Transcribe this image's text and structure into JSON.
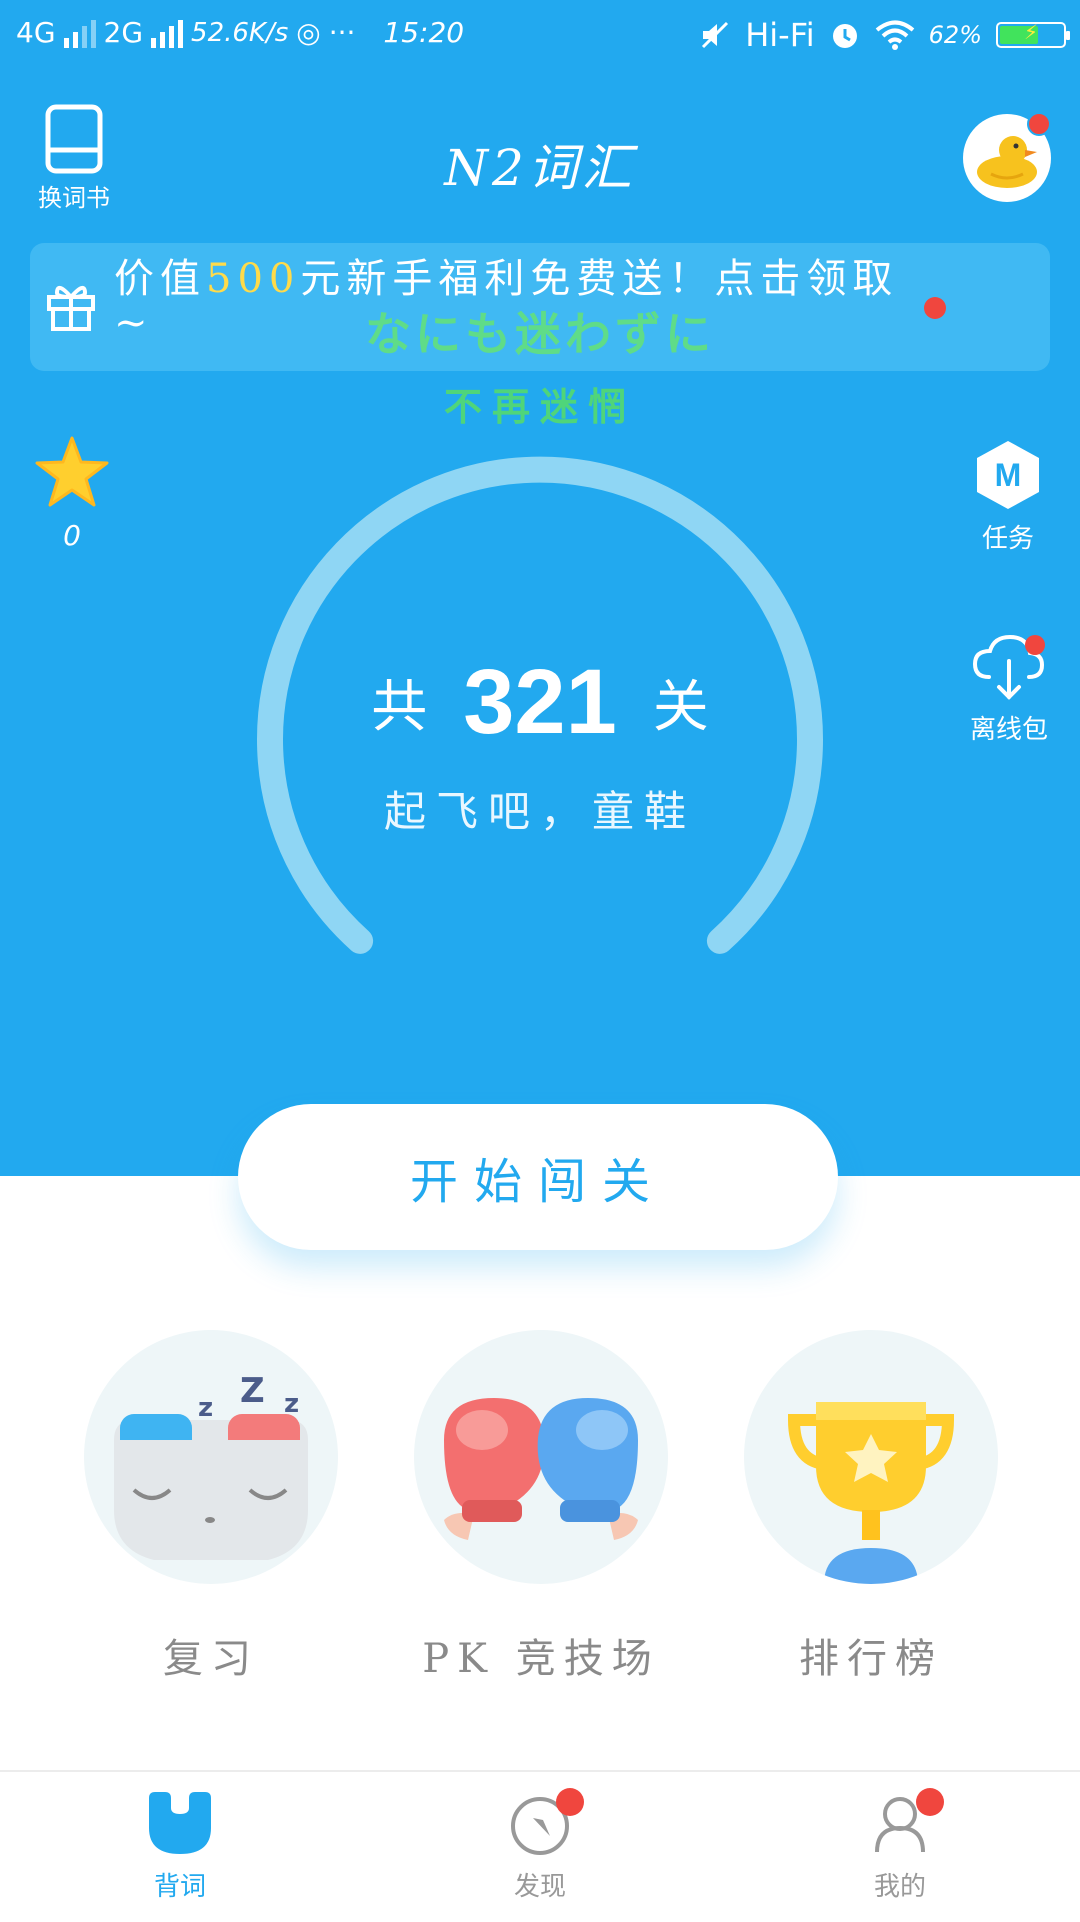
{
  "status_bar": {
    "network1": "4G",
    "network2": "2G",
    "speed": "52.6K/s",
    "time": "15:20",
    "hifi": "Hi-Fi",
    "battery": "62%",
    "battery_level": 0.62,
    "icons": [
      "signal-icon",
      "weibo-icon",
      "more-dots-icon",
      "mute-icon",
      "alarm-icon",
      "wifi-icon",
      "battery-icon"
    ]
  },
  "header": {
    "book_label": "换词书",
    "title": "N2词汇"
  },
  "banner": {
    "text_before": "价值",
    "text_highlight": "500",
    "text_after": "元新手福利免费送！点击领取~",
    "highlight_color": "#ffdb4a"
  },
  "overlay": {
    "japanese": "なにも迷わずに",
    "chinese": "不再迷惘"
  },
  "stars": {
    "count": "0"
  },
  "side_actions": {
    "task_label": "任务",
    "task_badge": "M",
    "offline_label": "离线包"
  },
  "progress": {
    "prefix": "共",
    "total": "321",
    "suffix": "关",
    "slogan": "起飞吧，童鞋"
  },
  "start_button": {
    "label": "开始闯关"
  },
  "features": [
    {
      "label": "复习",
      "icon": "sleeping-face-icon"
    },
    {
      "label": "PK 竞技场",
      "icon": "boxing-gloves-icon"
    },
    {
      "label": "排行榜",
      "icon": "trophy-icon"
    }
  ],
  "tabs": [
    {
      "label": "背词",
      "icon": "study-icon",
      "active": true
    },
    {
      "label": "发现",
      "icon": "compass-icon",
      "active": false
    },
    {
      "label": "我的",
      "icon": "profile-icon",
      "active": false
    }
  ],
  "colors": {
    "primary": "#22a9ef",
    "badge": "#f0463e",
    "inactive": "#999999"
  }
}
